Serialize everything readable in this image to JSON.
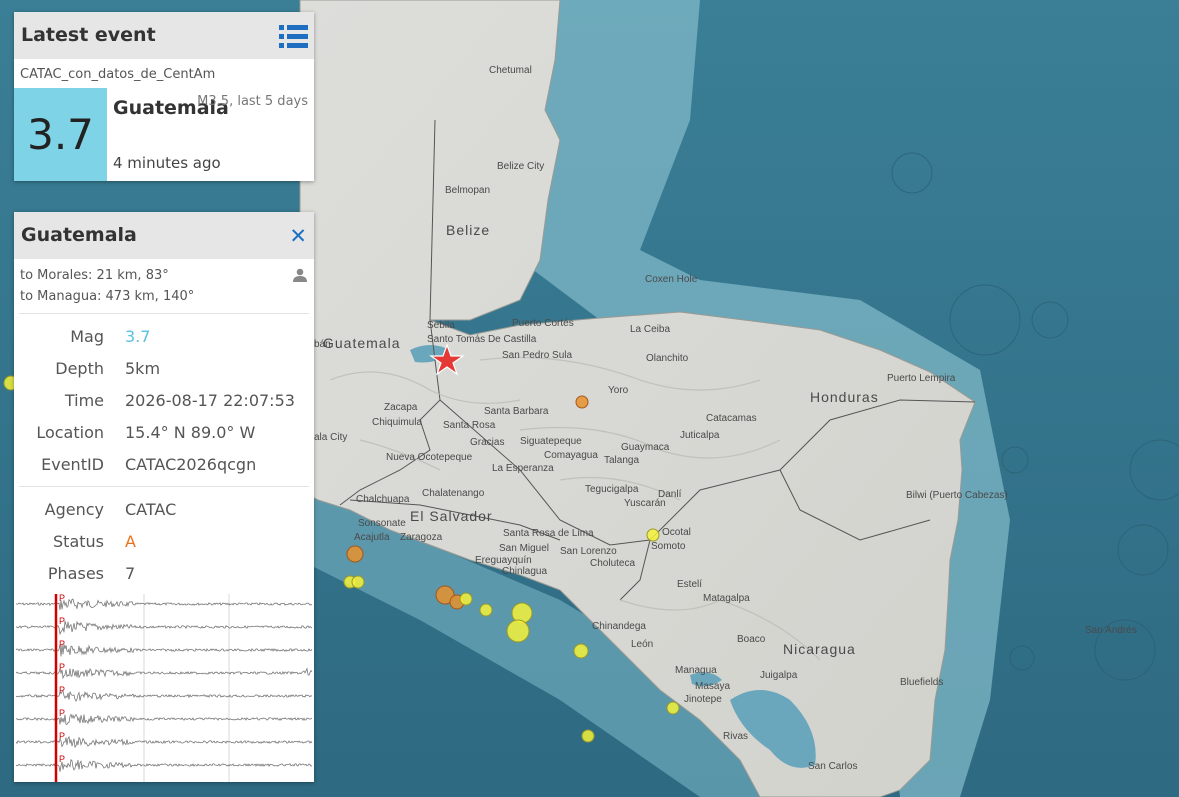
{
  "latest_event": {
    "title": "Latest event",
    "network": "CATAC_con_datos_de_CentAm",
    "magnitude": "3.7",
    "region": "Guatemala",
    "summary": "M3.5, last 5 days",
    "time_ago": "4 minutes ago"
  },
  "detail": {
    "title": "Guatemala",
    "distance_1": "to Morales: 21 km, 83°",
    "distance_2": "to Managua: 473 km, 140°",
    "rows": [
      {
        "label": "Mag",
        "value": "3.7"
      },
      {
        "label": "Depth",
        "value": "5km"
      },
      {
        "label": "Time",
        "value": "2026-08-17 22:07:53"
      },
      {
        "label": "Location",
        "value": "15.4° N 89.0° W"
      },
      {
        "label": "EventID",
        "value": "CATAC2026qcgn"
      },
      {
        "label": "Agency",
        "value": "CATAC"
      },
      {
        "label": "Status",
        "value": "A"
      },
      {
        "label": "Phases",
        "value": "7"
      }
    ],
    "pick_label": "P"
  },
  "map": {
    "countries": [
      "Belize",
      "Guatemala",
      "Honduras",
      "El Salvador",
      "Nicaragua"
    ],
    "places": [
      "Chetumal",
      "Belize City",
      "Belmopan",
      "Sebila",
      "Santo Tomás De Castilla",
      "Puerto Cortés",
      "La Ceiba",
      "San Pedro Sula",
      "Olanchito",
      "Coxen Hole",
      "Puerto Lempira",
      "Yoro",
      "Santa Barbara",
      "Catacamas",
      "Zacapa",
      "Chiquimula",
      "Santa Rosa",
      "Gracias",
      "Siguatepeque",
      "Comayagua",
      "Guaymaca",
      "Juticalpa",
      "ala City",
      "Nueva Ocotepeque",
      "La Esperanza",
      "Talanga",
      "Tegucigalpa",
      "Danlí",
      "Yuscarán",
      "Chalchuapa",
      "Chalatenango",
      "Sonsonate",
      "Acajutla",
      "Zaragoza",
      "Santa Rosa de Lima",
      "San Miguel",
      "Ereguayquín",
      "Chinlagua",
      "San Lorenzo",
      "Choluteca",
      "Ocotal",
      "Somoto",
      "Estelí",
      "Matagalpa",
      "Chinandega",
      "León",
      "Boaco",
      "Managua",
      "Masaya",
      "Jinotepe",
      "Juigalpa",
      "Rivas",
      "San Carlos",
      "Bilwi (Puerto Cabezas)",
      "Bluefields",
      "San Andrés",
      "bán"
    ]
  },
  "colors": {
    "mag_box": "#7fd3e6",
    "mag_value": "#5bc0de",
    "status_value": "#e8731c",
    "event_star": "#e53935",
    "recent_quake": "#f5f23a",
    "older_quake": "#e8922d",
    "pick_line": "#d40000"
  },
  "icons": {
    "list": "list-icon",
    "close": "close-icon",
    "user": "user-icon",
    "event": "star-icon"
  }
}
